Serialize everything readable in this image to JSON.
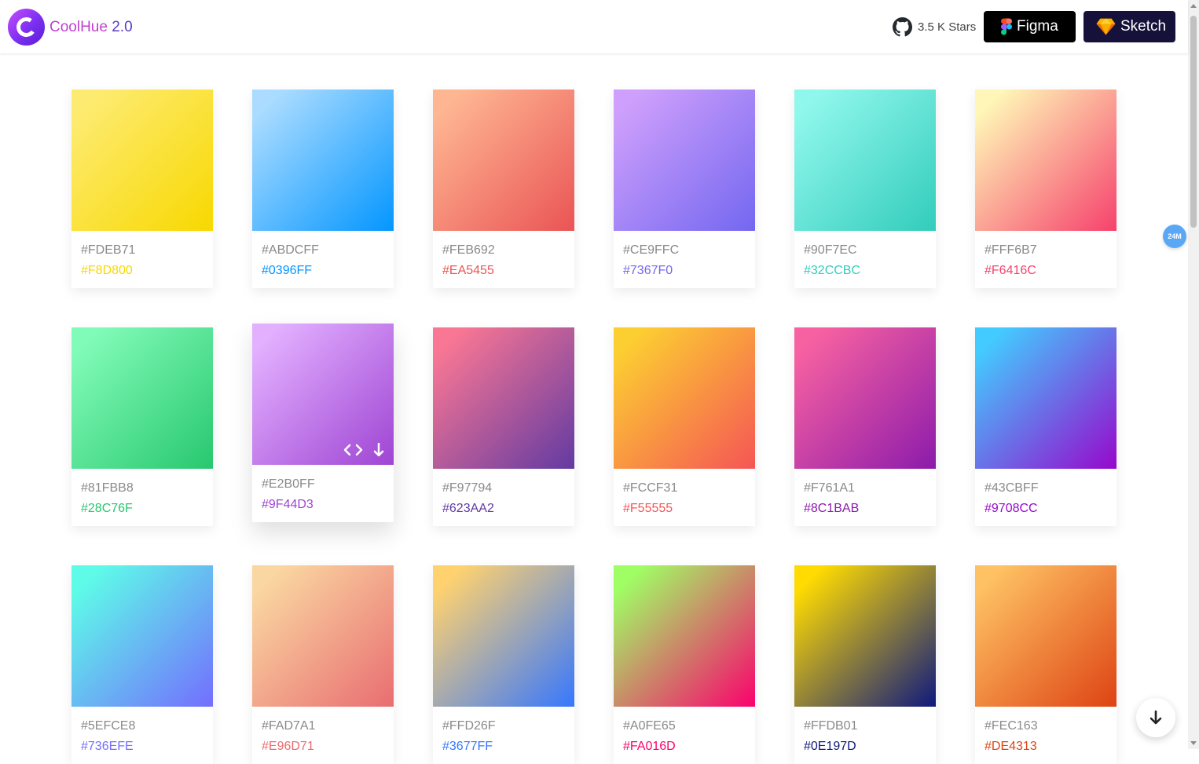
{
  "header": {
    "brand_name": "CoolHue",
    "brand_version": "2.0",
    "github_stars": "3.5 K Stars",
    "figma_label": "Figma",
    "sketch_label": "Sketch"
  },
  "badge": "24M",
  "gradients": [
    {
      "start": "#FDEB71",
      "end": "#F8D800"
    },
    {
      "start": "#ABDCFF",
      "end": "#0396FF"
    },
    {
      "start": "#FEB692",
      "end": "#EA5455"
    },
    {
      "start": "#CE9FFC",
      "end": "#7367F0"
    },
    {
      "start": "#90F7EC",
      "end": "#32CCBC"
    },
    {
      "start": "#FFF6B7",
      "end": "#F6416C"
    },
    {
      "start": "#81FBB8",
      "end": "#28C76F"
    },
    {
      "start": "#E2B0FF",
      "end": "#9F44D3"
    },
    {
      "start": "#F97794",
      "end": "#623AA2"
    },
    {
      "start": "#FCCF31",
      "end": "#F55555"
    },
    {
      "start": "#F761A1",
      "end": "#8C1BAB"
    },
    {
      "start": "#43CBFF",
      "end": "#9708CC"
    },
    {
      "start": "#5EFCE8",
      "end": "#736EFE"
    },
    {
      "start": "#FAD7A1",
      "end": "#E96D71"
    },
    {
      "start": "#FFD26F",
      "end": "#3677FF"
    },
    {
      "start": "#A0FE65",
      "end": "#FA016D"
    },
    {
      "start": "#FFDB01",
      "end": "#0E197D"
    },
    {
      "start": "#FEC163",
      "end": "#DE4313"
    }
  ]
}
